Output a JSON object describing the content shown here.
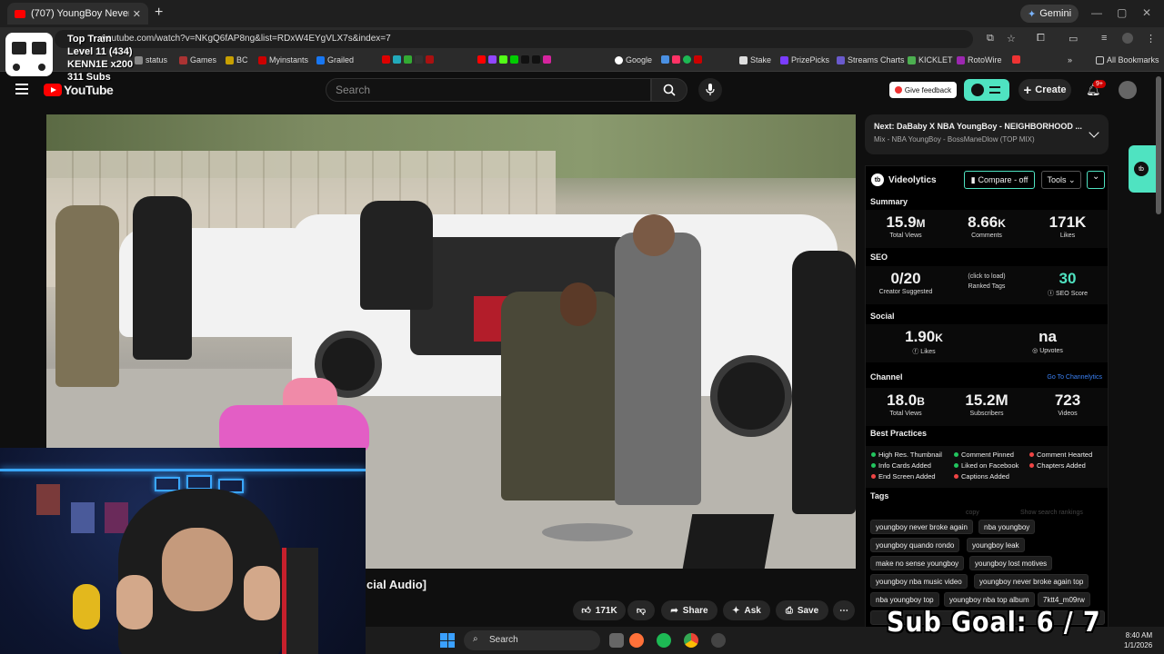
{
  "browser": {
    "tab_title": "(707) YoungBoy Never Bro...",
    "new_tab": "+",
    "gemini_label": "Gemini",
    "url": "youtube.com/watch?v=NKgQ6fAP8ng&list=RDxW4EYgVLX7s&index=7",
    "bookmarks": [
      "status",
      "Games",
      "BC",
      "Myinstants",
      "Grailed",
      "Google",
      "Stake",
      "PrizePicks",
      "Streams Charts",
      "KICKLET",
      "RotoWire"
    ],
    "all_bookmarks": "All Bookmarks"
  },
  "overlay": {
    "top_train": "Top Train",
    "level": "Level 11  (434)",
    "user": "KENN1E x200",
    "subs": "311 Subs",
    "sub_goal": "Sub Goal:  6 / 7"
  },
  "youtube": {
    "logo_text": "YouTube",
    "search_placeholder": "Search",
    "feedback_label": "Give feedback",
    "create_label": "Create",
    "notif_badge": "9+",
    "video_title_visible": "cial Audio]",
    "likes": "171K",
    "share_label": "Share",
    "ask_label": "Ask",
    "save_label": "Save",
    "more_label": "⋯"
  },
  "next_card": {
    "title_prefix": "Next: ",
    "title": "DaBaby X NBA YoungBoy - NEIGHBORHOOD ...",
    "subtitle": "Mix - NBA YoungBoy - BossManeDlow (TOP MIX)"
  },
  "videolytics": {
    "name": "Videolytics",
    "compare": "Compare - off",
    "tools": "Tools",
    "summary_label": "Summary",
    "summary": [
      {
        "big": "15.9",
        "unit": "M",
        "label": "Total Views"
      },
      {
        "big": "8.66",
        "unit": "K",
        "label": "Comments"
      },
      {
        "big": "171K",
        "unit": "",
        "label": "Likes"
      }
    ],
    "seo_label": "SEO",
    "seo": {
      "creator_suggested_value": "0/20",
      "creator_suggested_label": "Creator Suggested",
      "ranked_tags_value": "(click to load)",
      "ranked_tags_label": "Ranked Tags",
      "score_value": "30",
      "score_label": "SEO Score"
    },
    "social_label": "Social",
    "social": {
      "likes_value": "1.90",
      "likes_unit": "K",
      "likes_label": "Likes",
      "upvotes_value": "na",
      "upvotes_label": "Upvotes"
    },
    "channel_label": "Channel",
    "channel_link": "Go To Channelytics",
    "channel": [
      {
        "big": "18.0",
        "unit": "B",
        "label": "Total Views"
      },
      {
        "big": "15.2M",
        "unit": "",
        "label": "Subscribers"
      },
      {
        "big": "723",
        "unit": "",
        "label": "Videos"
      }
    ],
    "best_practices_label": "Best Practices",
    "best_practices": [
      {
        "text": "High Res. Thumbnail",
        "ok": true
      },
      {
        "text": "Comment Pinned",
        "ok": true
      },
      {
        "text": "Comment Hearted",
        "ok": false
      },
      {
        "text": "Info Cards Added",
        "ok": true
      },
      {
        "text": "Liked on Facebook",
        "ok": true
      },
      {
        "text": "Chapters Added",
        "ok": false
      },
      {
        "text": "End Screen Added",
        "ok": false
      },
      {
        "text": "Captions Added",
        "ok": false
      }
    ],
    "tags_label": "Tags",
    "copy_label": "copy",
    "show_rankings": "Show search rankings",
    "tags": [
      "youngboy never broke again",
      "nba youngboy",
      "youngboy quando rondo",
      "youngboy leak",
      "make no sense youngboy",
      "youngboy lost motives",
      "youngboy nba music video",
      "youngboy never broke again top",
      "nba youngboy top",
      "youngboy nba top album",
      "7ktt4_m09rw"
    ],
    "colors": {
      "accent": "#4fe3c1",
      "ok": "#22c55e",
      "bad": "#ef4444"
    }
  },
  "taskbar": {
    "search_label": "Search",
    "time": "8:40 AM",
    "date": "1/1/2026"
  }
}
